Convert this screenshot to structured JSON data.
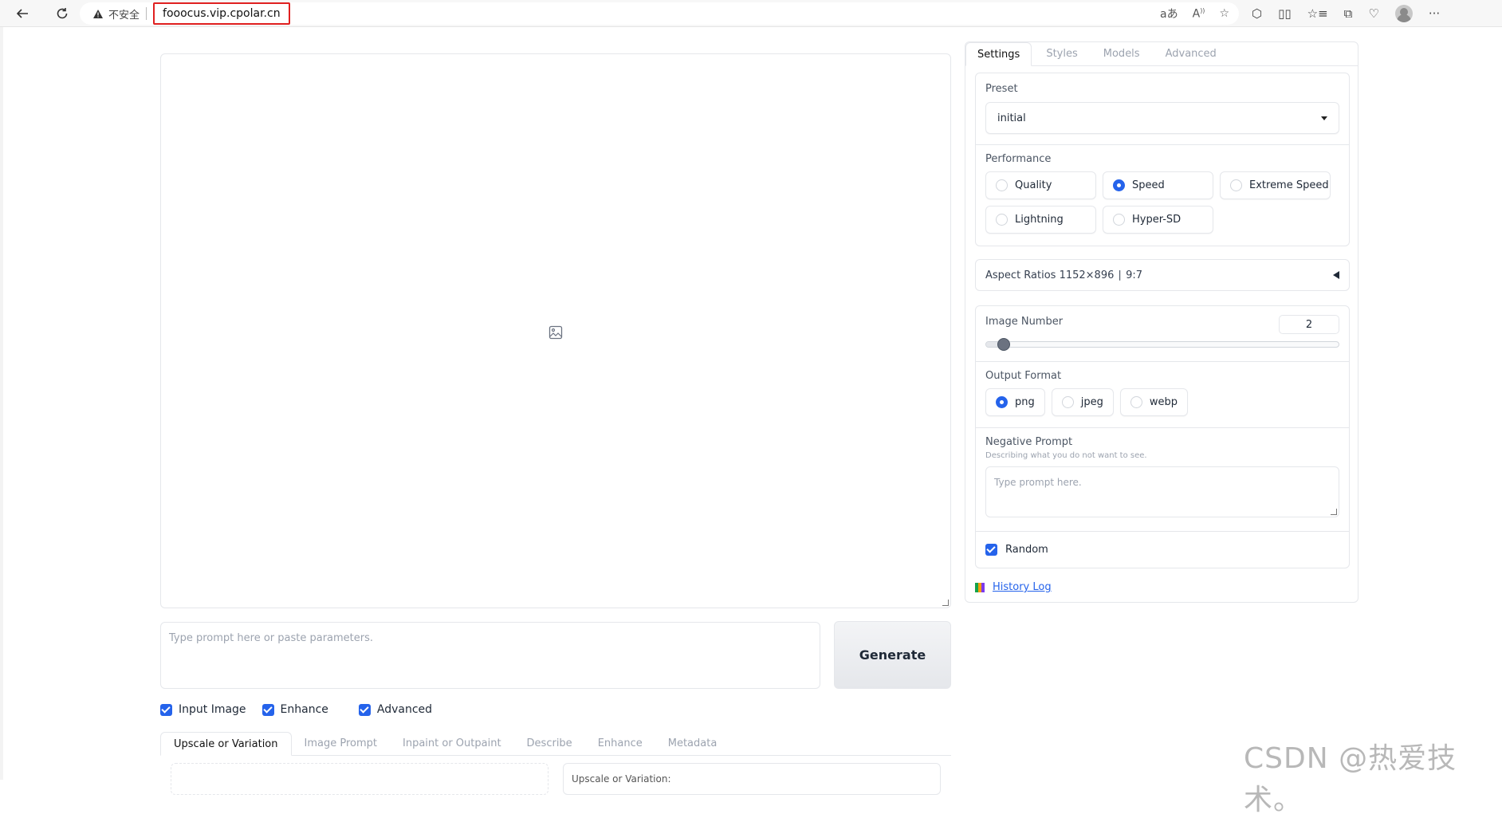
{
  "browser": {
    "security_label": "不安全",
    "url": "fooocus.vip.cpolar.cn",
    "read_aloud_label": "Á",
    "translate_label": "aあ"
  },
  "main": {
    "prompt_placeholder": "Type prompt here or paste parameters.",
    "generate_label": "Generate",
    "checkboxes": [
      {
        "label": "Input Image",
        "checked": true
      },
      {
        "label": "Enhance",
        "checked": true
      },
      {
        "label": "Advanced",
        "checked": true
      }
    ],
    "tabs": [
      "Upscale or Variation",
      "Image Prompt",
      "Inpaint or Outpaint",
      "Describe",
      "Enhance",
      "Metadata"
    ],
    "active_tab": "Upscale or Variation",
    "panel_b_label": "Upscale or Variation:"
  },
  "side": {
    "tabs": [
      "Settings",
      "Styles",
      "Models",
      "Advanced"
    ],
    "active_tab": "Settings",
    "preset_label": "Preset",
    "preset_value": "initial",
    "performance_label": "Performance",
    "performance_options": [
      {
        "label": "Quality",
        "selected": false
      },
      {
        "label": "Speed",
        "selected": true
      },
      {
        "label": "Extreme Speed",
        "selected": false
      },
      {
        "label": "Lightning",
        "selected": false
      },
      {
        "label": "Hyper-SD",
        "selected": false
      }
    ],
    "aspect_label": "Aspect Ratios 1152×896 ∣ 9:7",
    "image_number_label": "Image Number",
    "image_number_value": "2",
    "image_number_fraction": 0.032,
    "output_format_label": "Output Format",
    "output_formats": [
      {
        "label": "png",
        "selected": true
      },
      {
        "label": "jpeg",
        "selected": false
      },
      {
        "label": "webp",
        "selected": false
      }
    ],
    "negative_label": "Negative Prompt",
    "negative_sub": "Describing what you do not want to see.",
    "negative_placeholder": "Type prompt here.",
    "random_label": "Random",
    "history_label": "History Log"
  },
  "watermark": "CSDN @热爱技术。",
  "colors": {
    "accent": "#2563eb",
    "url_highlight": "#e02020"
  }
}
